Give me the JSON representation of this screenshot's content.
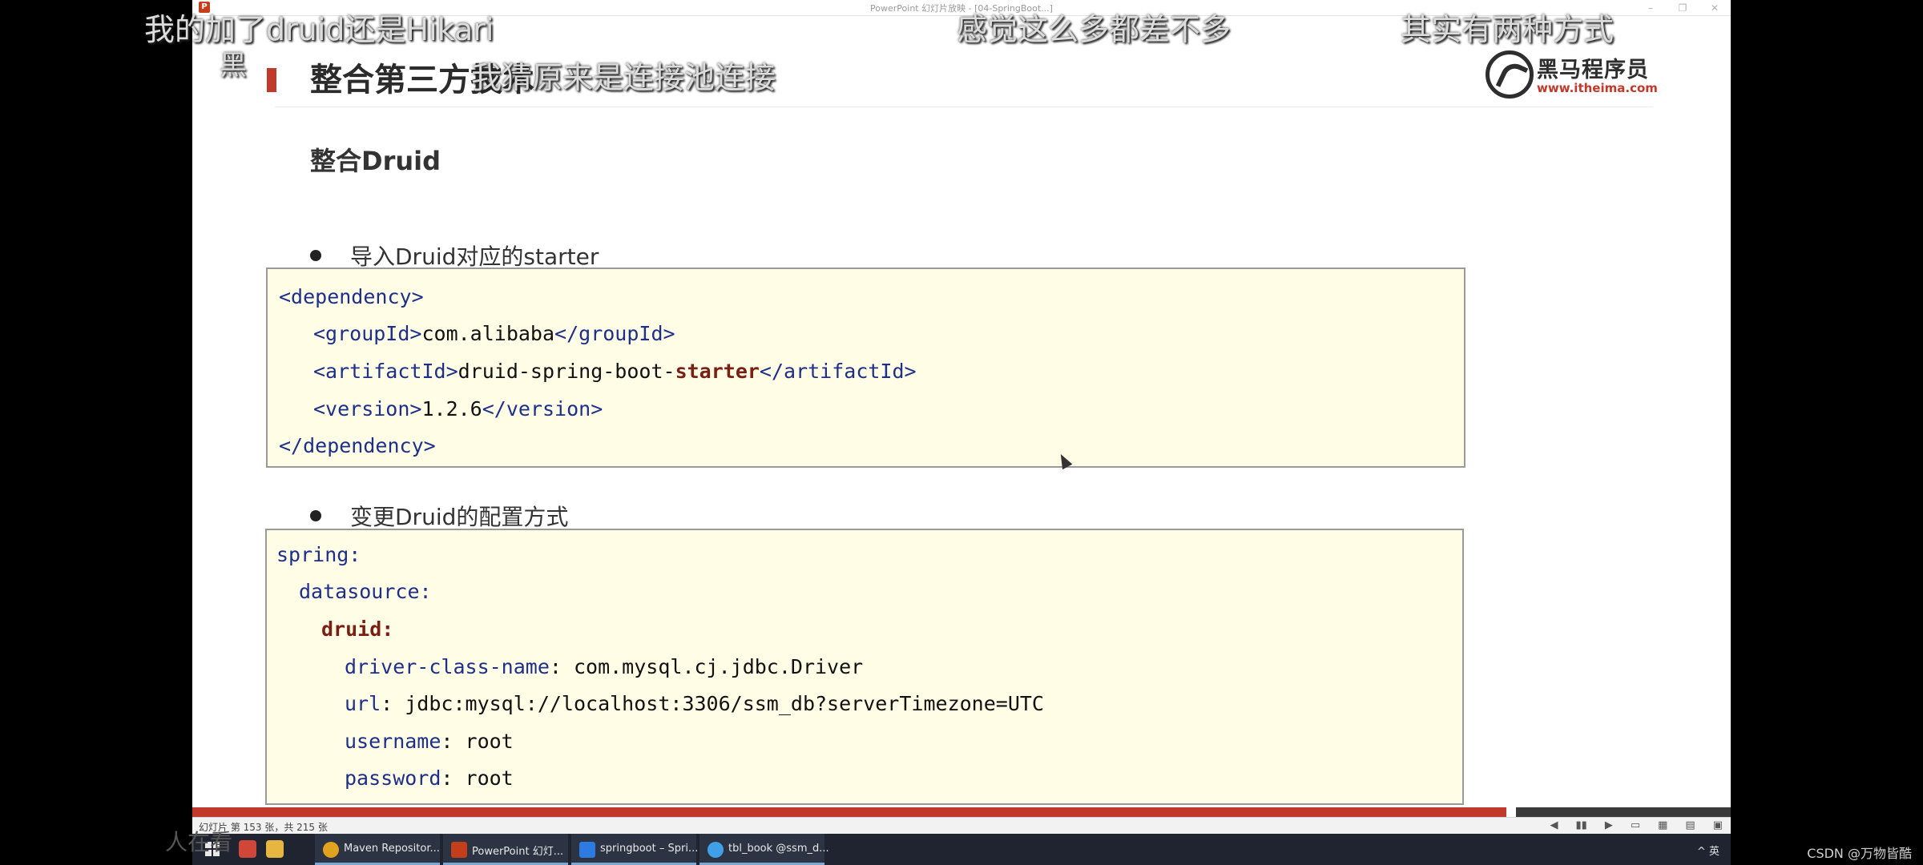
{
  "window": {
    "title": "PowerPoint 幻灯片放映 - [04-SpringBoot...]",
    "app_icon_letter": "P",
    "minimize_glyph": "–",
    "maximize_glyph": "❐",
    "close_glyph": "✕"
  },
  "slide": {
    "title": "整合第三方技术",
    "logo": {
      "name": "黑马程序员",
      "url": "www.itheima.com",
      "icon": "horse-logo-icon"
    },
    "section_heading": "整合Druid",
    "bullets": [
      {
        "label": "导入Druid对应的starter"
      },
      {
        "label": "变更Druid的配置方式"
      }
    ],
    "maven_code": {
      "l1": "<dependency>",
      "l2_open": "<groupId>",
      "l2_val": "com.alibaba",
      "l2_close": "</groupId>",
      "l3_open": "<artifactId>",
      "l3_val": "druid-spring-boot-",
      "l3_hl": "starter",
      "l3_close": "</artifactId>",
      "l4_open": "<version>",
      "l4_val": "1.2.6",
      "l4_close": "</version>",
      "l5": "</dependency>"
    },
    "yaml_code": {
      "spring": "spring:",
      "datasource": "datasource:",
      "druid": "druid:",
      "driver_key": "driver-class-name",
      "driver_val": ": com.mysql.cj.jdbc.Driver",
      "url_key": "url",
      "url_val": ": jdbc:mysql://localhost:3306/ssm_db?serverTimezone=UTC",
      "username_key": "username",
      "username_val": ": root",
      "password_key": "password",
      "password_val": ": root"
    }
  },
  "progress": {
    "current": 153,
    "total": 215
  },
  "status_bar": {
    "text": "幻灯片 第 153 张，共 215 张",
    "icons": [
      "prev-icon",
      "pause-icon",
      "next-icon",
      "normal-view-icon",
      "slide-sorter-icon",
      "reading-view-icon",
      "slideshow-icon"
    ]
  },
  "taskbar": {
    "tasks": [
      {
        "label": "Maven Repositor...",
        "color": "#e0a21f"
      },
      {
        "label": "PowerPoint 幻灯...",
        "color": "#c43e1c"
      },
      {
        "label": "springboot – Spri...",
        "color": "#2d7be0"
      },
      {
        "label": "tbl_book @ssm_d...",
        "color": "#3fa0e8"
      }
    ],
    "tray": "^  英"
  },
  "subtitles": {
    "top_left": "我的加了druid还是Hikari",
    "top_center": "感觉这么多都差不多",
    "top_right": "其实有两种方式",
    "mid": "我猜原来是连接池连接",
    "left_char": "黑",
    "bottom_left": "人在看"
  },
  "watermark": "CSDN @万物皆酷"
}
